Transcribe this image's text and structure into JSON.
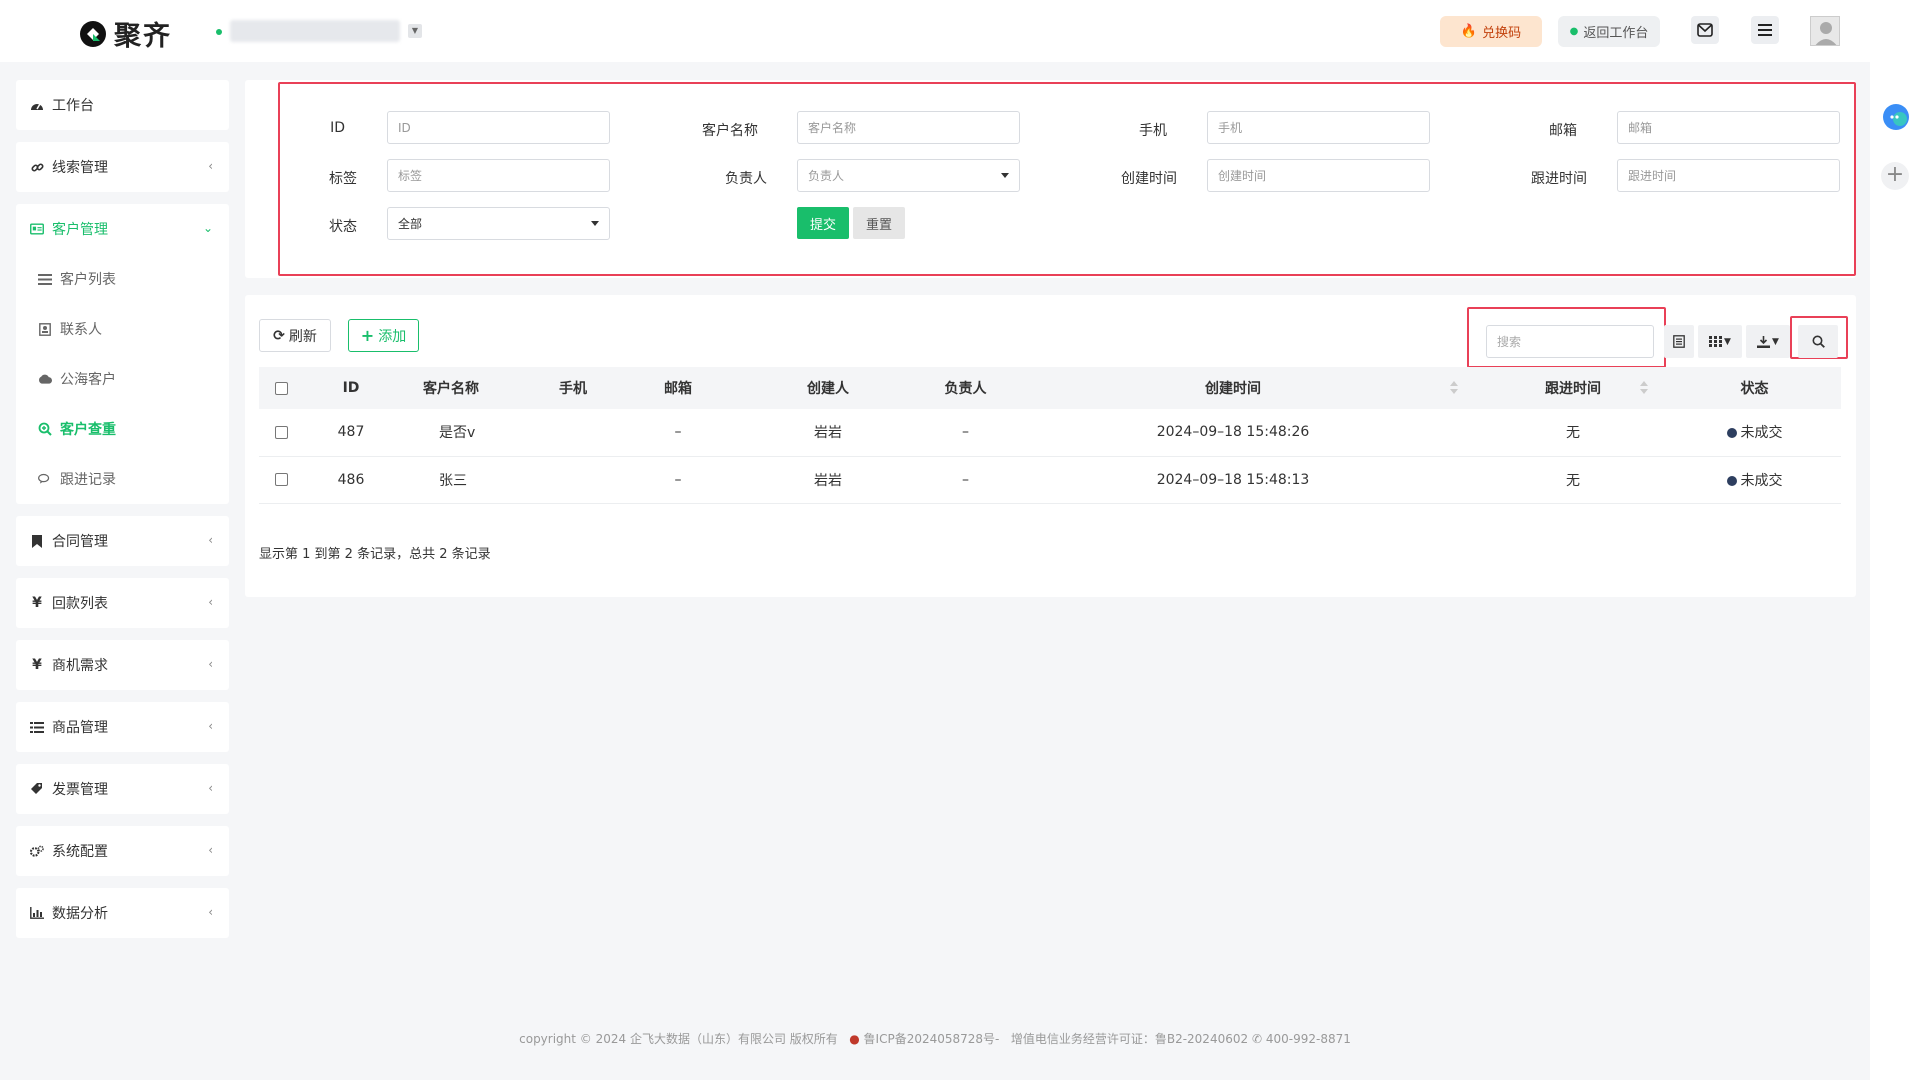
{
  "app": {
    "brand": "聚齐"
  },
  "header": {
    "redeem_label": "兑换码",
    "back_label": "返回工作台"
  },
  "sidebar": {
    "workbench": "工作台",
    "leads": "线索管理",
    "customers": "客户管理",
    "customer_subs": [
      "客户列表",
      "联系人",
      "公海客户",
      "客户查重",
      "跟进记录"
    ],
    "contracts": "合同管理",
    "payments": "回款列表",
    "opportunities": "商机需求",
    "products": "商品管理",
    "invoices": "发票管理",
    "settings": "系统配置",
    "analytics": "数据分析"
  },
  "filters": {
    "id_label": "ID",
    "id_placeholder": "ID",
    "name_label": "客户名称",
    "name_placeholder": "客户名称",
    "phone_label": "手机",
    "phone_placeholder": "手机",
    "email_label": "邮箱",
    "email_placeholder": "邮箱",
    "tag_label": "标签",
    "tag_placeholder": "标签",
    "owner_label": "负责人",
    "owner_placeholder": "负责人",
    "created_label": "创建时间",
    "created_placeholder": "创建时间",
    "followed_label": "跟进时间",
    "followed_placeholder": "跟进时间",
    "status_label": "状态",
    "status_value": "全部",
    "submit": "提交",
    "reset": "重置"
  },
  "toolbar": {
    "refresh": "刷新",
    "add": "添加",
    "search_placeholder": "搜索"
  },
  "table": {
    "columns": [
      "ID",
      "客户名称",
      "手机",
      "邮箱",
      "创建人",
      "负责人",
      "创建时间",
      "跟进时间",
      "状态"
    ],
    "rows": [
      {
        "id": "487",
        "name": "是否v",
        "phone": "",
        "email": "–",
        "creator": "岩岩",
        "owner": "–",
        "created": "2024–09–18 15:48:26",
        "followed": "无",
        "status": "未成交"
      },
      {
        "id": "486",
        "name": "张三",
        "phone": "",
        "email": "–",
        "creator": "岩岩",
        "owner": "–",
        "created": "2024–09–18 15:48:13",
        "followed": "无",
        "status": "未成交"
      }
    ],
    "page_info": "显示第 1 到第 2 条记录，总共 2 条记录"
  },
  "footer": {
    "text": "copyright © 2024 企飞大数据（山东）有限公司 版权所有",
    "icp": "鲁ICP备2024058728号-",
    "license": "增值电信业务经营许可证：鲁B2-20240602",
    "phone": "400-992-8871"
  },
  "colors": {
    "accent": "#19be6b",
    "highlight": "#e94057"
  }
}
